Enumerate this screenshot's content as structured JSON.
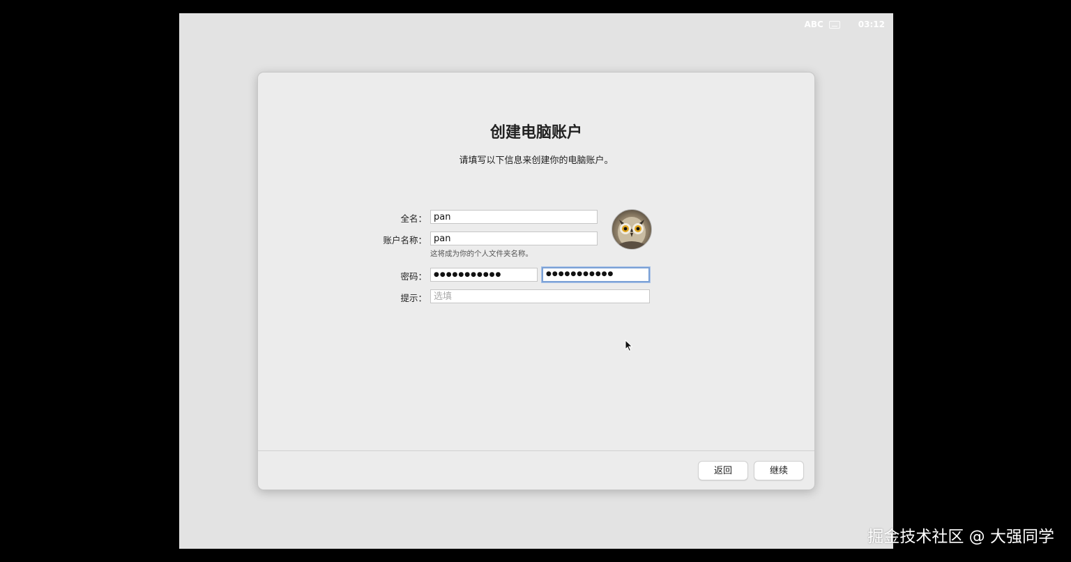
{
  "status_bar": {
    "input_method": "ABC",
    "input_icon": "keyboard-icon",
    "time": "03:12"
  },
  "dialog": {
    "title": "创建电脑账户",
    "subtitle": "请填写以下信息来创建你的电脑账户。",
    "full_name": {
      "label": "全名：",
      "value": "pan"
    },
    "account_name": {
      "label": "账户名称：",
      "value": "pan",
      "note": "这将成为你的个人文件夹名称。"
    },
    "password": {
      "label": "密码：",
      "value": "●●●●●●●●●●●",
      "verify_value": "●●●●●●●●●●●"
    },
    "hint": {
      "label": "提示：",
      "placeholder": "选填"
    },
    "avatar_icon": "owl-avatar-icon",
    "buttons": {
      "back": "返回",
      "continue": "继续"
    }
  },
  "watermark": "掘金技术社区 @ 大强同学",
  "colors": {
    "focus_ring": "#7ba1d6",
    "dialog_bg": "#ececec",
    "screen_bg": "#e3e3e3"
  }
}
